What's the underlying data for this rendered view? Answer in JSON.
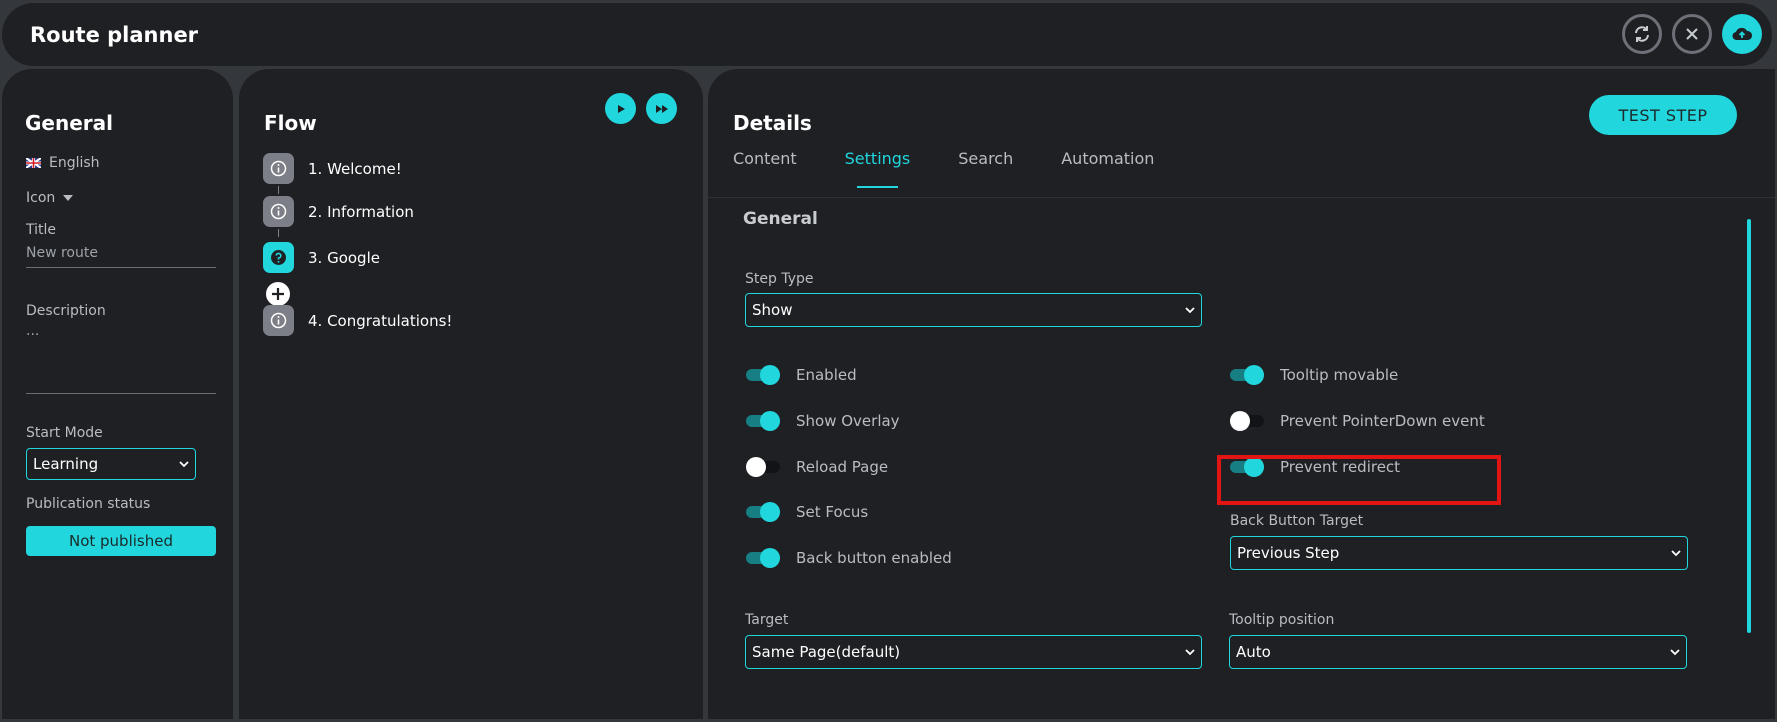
{
  "app": {
    "title": "Route planner",
    "actions": [
      {
        "name": "refresh-icon"
      },
      {
        "name": "close-icon"
      },
      {
        "name": "cloud-upload-icon"
      }
    ]
  },
  "colors": {
    "accent": "#21d6dc",
    "panel": "#1e2024",
    "highlight": "#e31414"
  },
  "general": {
    "heading": "General",
    "language": "English",
    "language_icon": "uk-flag-icon",
    "icon_label": "Icon",
    "title_label": "Title",
    "title_value": "New route",
    "description_label": "Description",
    "description_value": "...",
    "start_mode_label": "Start Mode",
    "start_mode_value": "Learning",
    "publication_label": "Publication status",
    "publication_value": "Not published"
  },
  "flow": {
    "heading": "Flow",
    "steps": [
      {
        "label": "1.  Welcome!",
        "icon": "info-icon",
        "active": false
      },
      {
        "label": "2.  Information",
        "icon": "info-icon",
        "active": false
      },
      {
        "label": "3.  Google",
        "icon": "question-icon",
        "active": true
      },
      {
        "label": "4.  Congratulations!",
        "icon": "info-icon",
        "active": false
      }
    ]
  },
  "details": {
    "heading": "Details",
    "test_button": "TEST STEP",
    "tabs": [
      "Content",
      "Settings",
      "Search",
      "Automation"
    ],
    "active_tab": "Settings",
    "section_title": "General",
    "step_type_label": "Step Type",
    "step_type_value": "Show",
    "left_toggles": [
      {
        "label": "Enabled",
        "on": true
      },
      {
        "label": "Show Overlay",
        "on": true
      },
      {
        "label": "Reload Page",
        "on": false
      },
      {
        "label": "Set Focus",
        "on": true
      },
      {
        "label": "Back button enabled",
        "on": true
      }
    ],
    "right_toggles": [
      {
        "label": "Tooltip movable",
        "on": true
      },
      {
        "label": "Prevent PointerDown event",
        "on": false
      },
      {
        "label": "Prevent redirect",
        "on": true
      }
    ],
    "back_button_target_label": "Back Button Target",
    "back_button_target_value": "Previous Step",
    "target_label": "Target",
    "target_value": "Same Page(default)",
    "tooltip_position_label": "Tooltip position",
    "tooltip_position_value": "Auto"
  }
}
